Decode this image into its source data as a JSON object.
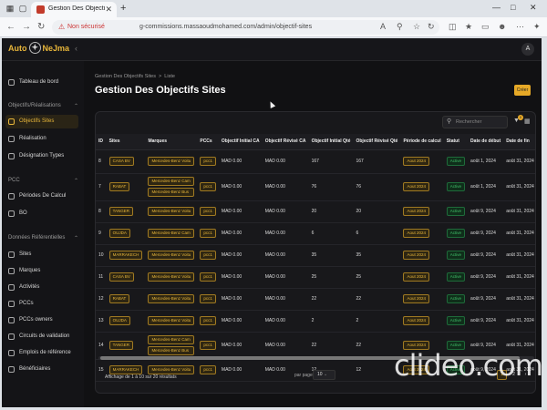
{
  "browser": {
    "tab_title": "Gestion Des Objectifs Sites - Auto",
    "new_tab": "+",
    "not_secure": "Non sécurisé",
    "url": "g-commissions.massaoudmohamed.com/admin/objectif-sites"
  },
  "app": {
    "logo_left": "Auto",
    "logo_right": "NeJma",
    "avatar_initial": "A"
  },
  "sidebar": {
    "dashboard": "Tableau de bord",
    "sections": [
      {
        "label": "Objectifs/Réalisations",
        "items": [
          "Objectifs Sites",
          "Réalisation",
          "Désignation Types"
        ]
      },
      {
        "label": "PCC",
        "items": [
          "Périodes De Calcul",
          "BO"
        ]
      },
      {
        "label": "Données Référentielles",
        "items": [
          "Sites",
          "Marques",
          "Activités",
          "PCCs",
          "PCCs owners",
          "Circuits de validation",
          "Emplois de référence",
          "Bénéficiaires"
        ]
      }
    ]
  },
  "main": {
    "breadcrumb_1": "Gestion Des Objectifs Sites",
    "breadcrumb_sep": ">",
    "breadcrumb_2": "Liste",
    "title": "Gestion Des Objectifs Sites",
    "create_label": "Créer",
    "search_placeholder": "Rechercher",
    "filter_badge": "0"
  },
  "table": {
    "headers": [
      "ID",
      "Sites",
      "Marques",
      "PCCs",
      "Objectif Initial CA",
      "Objectif Révisé CA",
      "Objectif Initial Qté",
      "Objectif Révisé Qté",
      "Période de calcul",
      "Statut",
      "Date de début",
      "Date de fin"
    ],
    "rows": [
      {
        "id": "8",
        "site": "CASA BV",
        "marques": [
          "Mercedes-Benz Voitu"
        ],
        "pcc": "pcc1",
        "oica": "MAD 0.00",
        "orca": "MAD 0.00",
        "oiq": "167",
        "orq": "167",
        "periode": "Aout 2024",
        "statut": "Active",
        "debut": "août 1, 2024",
        "fin": "août 31, 2024"
      },
      {
        "id": "7",
        "site": "RABAT",
        "marques": [
          "Mercedes-Benz Cam",
          "Mercedes-Benz Bus"
        ],
        "pcc": "pcc1",
        "oica": "MAD 0.00",
        "orca": "MAD 0.00",
        "oiq": "76",
        "orq": "76",
        "periode": "Aout 2024",
        "statut": "Active",
        "debut": "août 1, 2024",
        "fin": "août 31, 2024"
      },
      {
        "id": "8",
        "site": "TANGER",
        "marques": [
          "Mercedes-Benz Voitu"
        ],
        "pcc": "pcc1",
        "oica": "MAD 0.00",
        "orca": "MAD 0.00",
        "oiq": "20",
        "orq": "20",
        "periode": "Aout 2024",
        "statut": "Active",
        "debut": "août 9, 2024",
        "fin": "août 31, 2024"
      },
      {
        "id": "9",
        "site": "OUJDA",
        "marques": [
          "Mercedes-Benz Cam"
        ],
        "pcc": "pcc1",
        "oica": "MAD 0.00",
        "orca": "MAD 0.00",
        "oiq": "6",
        "orq": "6",
        "periode": "Aout 2024",
        "statut": "Active",
        "debut": "août 9, 2024",
        "fin": "août 31, 2024"
      },
      {
        "id": "10",
        "site": "MARRAKECH",
        "marques": [
          "Mercedes-Benz Voitu"
        ],
        "pcc": "pcc1",
        "oica": "MAD 0.00",
        "orca": "MAD 0.00",
        "oiq": "35",
        "orq": "35",
        "periode": "Aout 2024",
        "statut": "Active",
        "debut": "août 9, 2024",
        "fin": "août 31, 2024"
      },
      {
        "id": "11",
        "site": "CASA BV",
        "marques": [
          "Mercedes-Benz Voitu"
        ],
        "pcc": "pcc1",
        "oica": "MAD 0.00",
        "orca": "MAD 0.00",
        "oiq": "25",
        "orq": "25",
        "periode": "Aout 2024",
        "statut": "Active",
        "debut": "août 9, 2024",
        "fin": "août 31, 2024"
      },
      {
        "id": "12",
        "site": "RABAT",
        "marques": [
          "Mercedes-Benz Voitu"
        ],
        "pcc": "pcc1",
        "oica": "MAD 0.00",
        "orca": "MAD 0.00",
        "oiq": "22",
        "orq": "22",
        "periode": "Aout 2024",
        "statut": "Active",
        "debut": "août 9, 2024",
        "fin": "août 31, 2024"
      },
      {
        "id": "13",
        "site": "OUJDA",
        "marques": [
          "Mercedes-Benz Voitu"
        ],
        "pcc": "pcc1",
        "oica": "MAD 0.00",
        "orca": "MAD 0.00",
        "oiq": "2",
        "orq": "2",
        "periode": "Aout 2024",
        "statut": "Active",
        "debut": "août 9, 2024",
        "fin": "août 31, 2024"
      },
      {
        "id": "14",
        "site": "TANGER",
        "marques": [
          "Mercedes-Benz Cam",
          "Mercedes-Benz Bus"
        ],
        "pcc": "pcc1",
        "oica": "MAD 0.00",
        "orca": "MAD 0.00",
        "oiq": "22",
        "orq": "22",
        "periode": "Aout 2024",
        "statut": "Active",
        "debut": "août 9, 2024",
        "fin": "août 31, 2024"
      },
      {
        "id": "15",
        "site": "MARRAKECH",
        "marques": [
          "Mercedes-Benz Voitu"
        ],
        "pcc": "pcc1",
        "oica": "MAD 0.00",
        "orca": "MAD 0.00",
        "oiq": "12",
        "orq": "12",
        "periode": "Aout 2024",
        "statut": "Active",
        "debut": "août 9, 2024",
        "fin": "août 31, 2024"
      }
    ]
  },
  "footer": {
    "summary": "Affichage de 1 à 10 sur 20 résultats",
    "per_page_label": "par page",
    "per_page_value": "10",
    "pages": [
      "1",
      "2"
    ],
    "current_page": "1",
    "next": "›"
  },
  "watermark": "clideo.com"
}
